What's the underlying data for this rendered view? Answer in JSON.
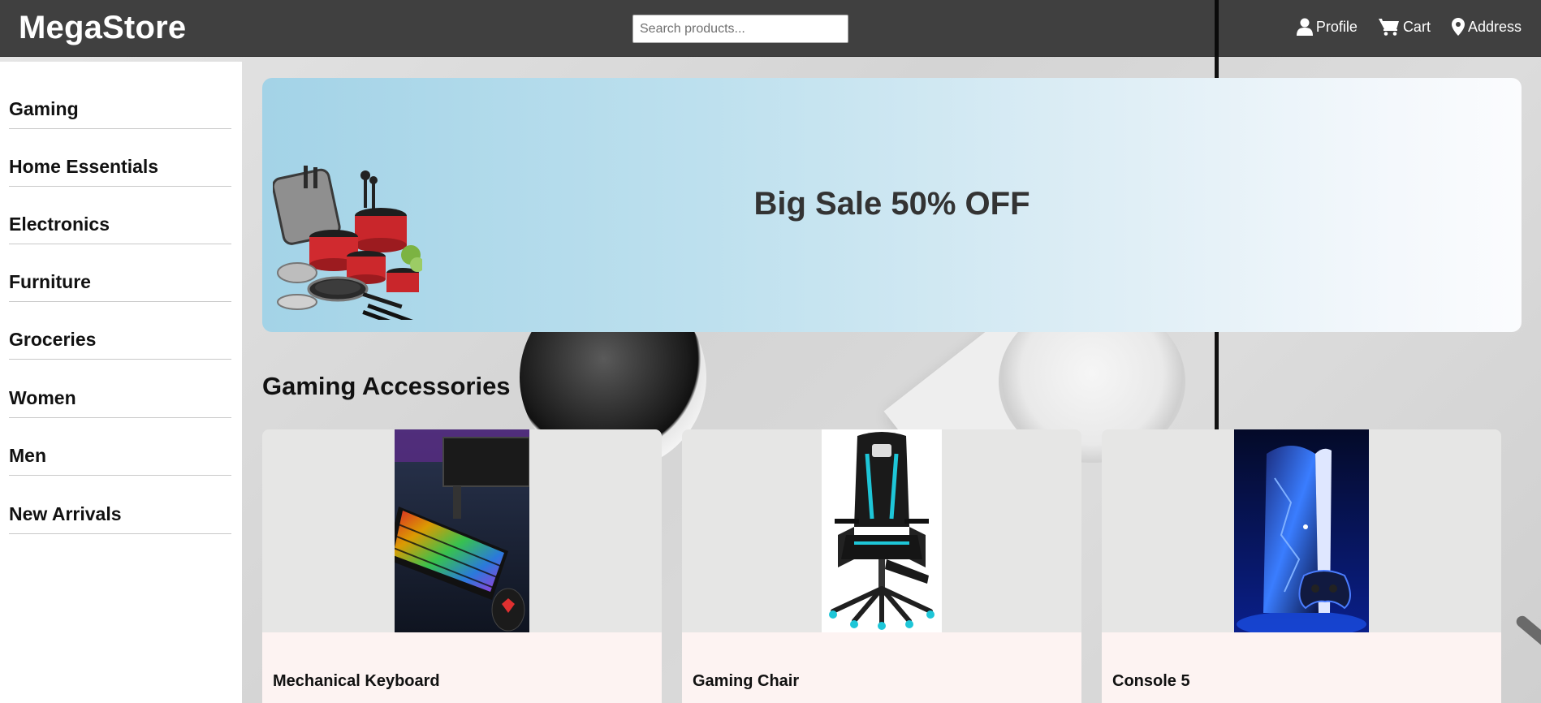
{
  "header": {
    "logo": "MegaStore",
    "search_placeholder": "Search products...",
    "links": [
      {
        "label": "Profile",
        "icon": "user-icon"
      },
      {
        "label": "Cart",
        "icon": "cart-icon"
      },
      {
        "label": "Address",
        "icon": "location-pin-icon"
      }
    ]
  },
  "sidebar": {
    "items": [
      {
        "label": "Gaming"
      },
      {
        "label": "Home Essentials"
      },
      {
        "label": "Electronics"
      },
      {
        "label": "Furniture"
      },
      {
        "label": "Groceries"
      },
      {
        "label": "Women"
      },
      {
        "label": "Men"
      },
      {
        "label": "New Arrivals"
      }
    ]
  },
  "banner": {
    "title": "Big Sale 50% OFF",
    "image": "cookware-set"
  },
  "section": {
    "title": "Gaming Accessories",
    "products": [
      {
        "name": "Mechanical Keyboard",
        "image": "keyboard-mouse"
      },
      {
        "name": "Gaming Chair",
        "image": "gaming-chair"
      },
      {
        "name": "Console 5",
        "image": "game-console"
      }
    ]
  },
  "colors": {
    "header_bg": "#404040",
    "banner_start": "#a3d3e7",
    "banner_end": "#fbfcfe",
    "card_info_bg": "#fdf3f2"
  }
}
